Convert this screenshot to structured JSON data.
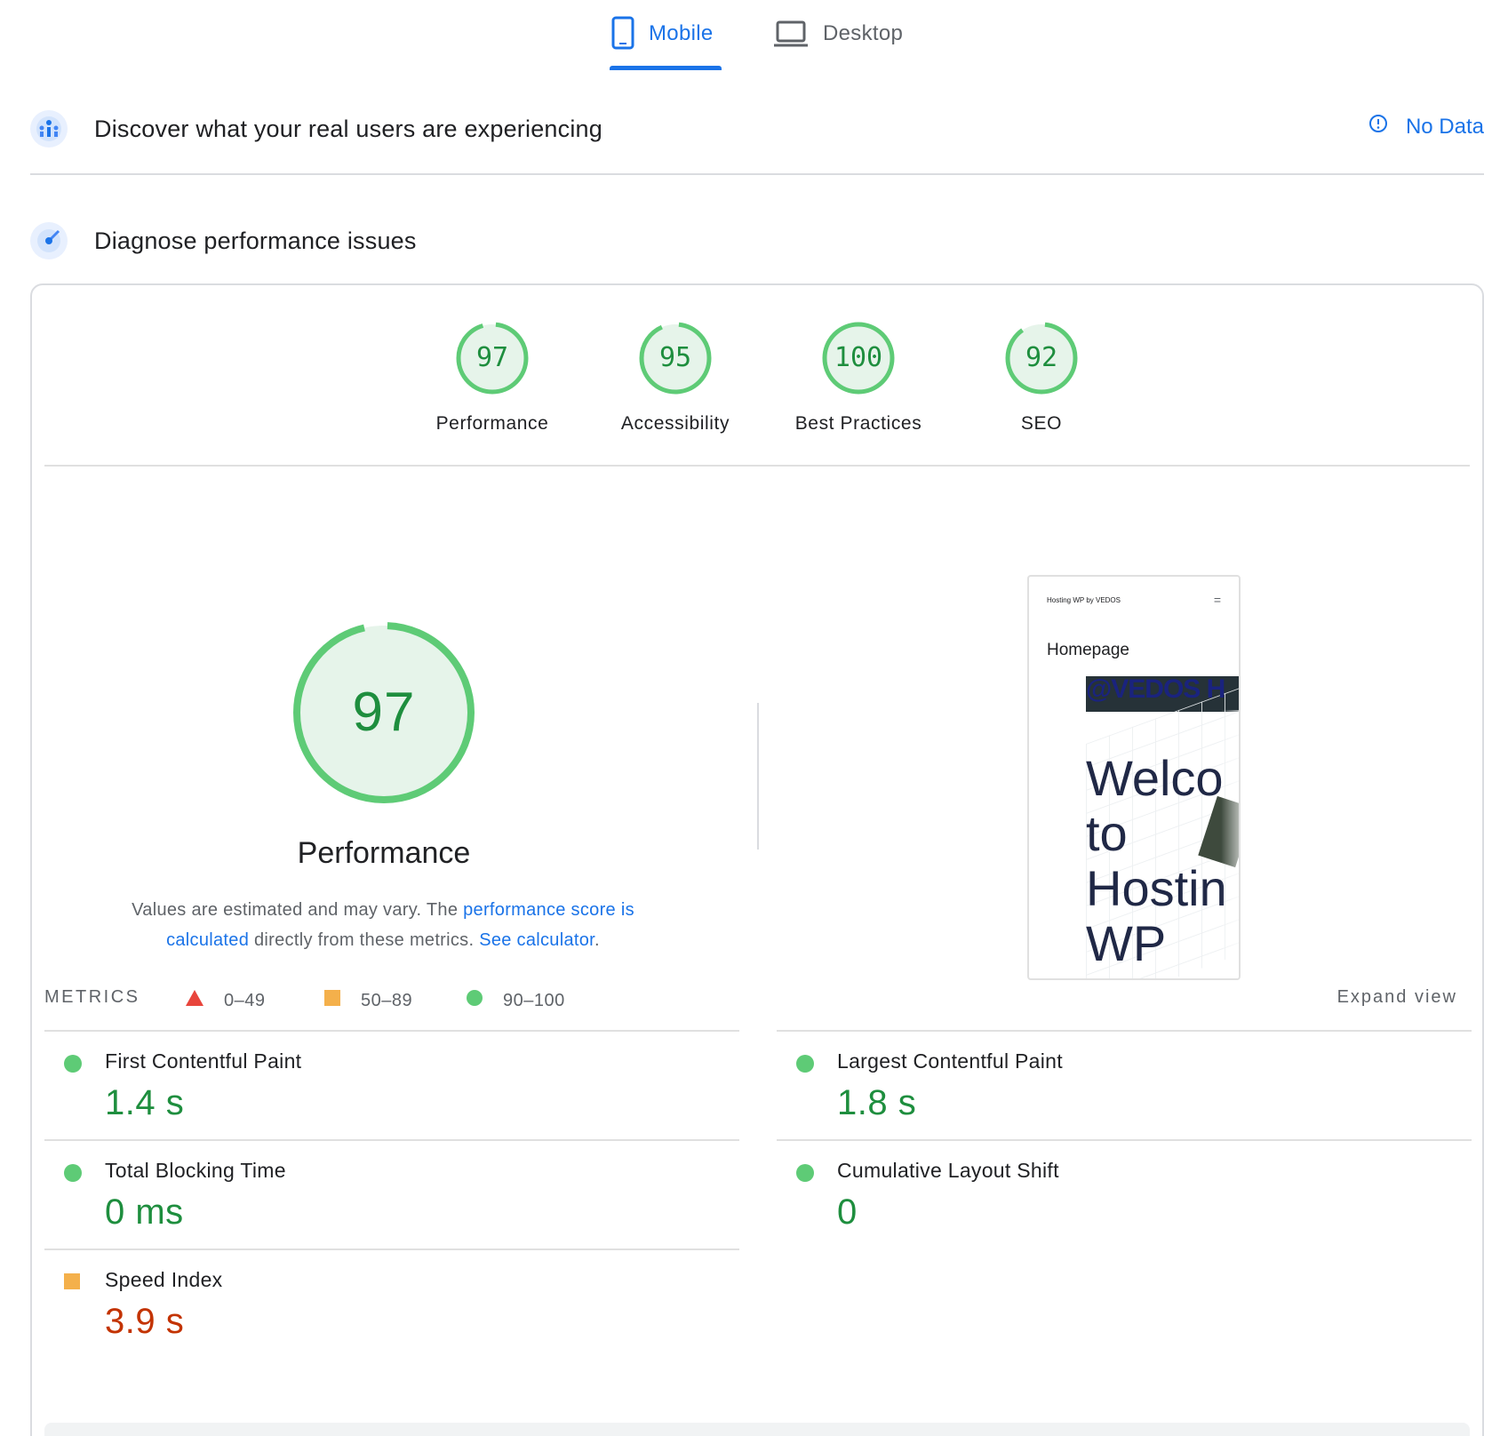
{
  "tabs": {
    "mobile_label": "Mobile",
    "desktop_label": "Desktop",
    "active": "Mobile"
  },
  "field_data": {
    "title": "Discover what your real users are experiencing",
    "status": "No Data",
    "status_icon": "info-icon"
  },
  "diagnose": {
    "title": "Diagnose performance issues"
  },
  "scores": [
    {
      "label": "Performance",
      "value": "97"
    },
    {
      "label": "Accessibility",
      "value": "95"
    },
    {
      "label": "Best Practices",
      "value": "100"
    },
    {
      "label": "SEO",
      "value": "92"
    }
  ],
  "performance": {
    "score": "97",
    "title": "Performance",
    "explain_text_1": "Values are estimated and may vary. The ",
    "explain_link_1": "performance score is calculated",
    "explain_text_2": " directly from these metrics. ",
    "explain_link_2": "See calculator",
    "explain_text_3": "."
  },
  "legend": [
    {
      "shape": "triangle",
      "range": "0–49",
      "color": "#e8453c"
    },
    {
      "shape": "square",
      "range": "50–89",
      "color": "#f4b04b"
    },
    {
      "shape": "circle",
      "range": "90–100",
      "color": "#5ecb76"
    }
  ],
  "screenshot": {
    "site_header": "Hosting WP by VEDOS",
    "menu_icon": "=",
    "page_title": "Homepage",
    "brand": "@VEDOS H",
    "hero_text": [
      "Welco",
      "to",
      "Hostin",
      "WP"
    ]
  },
  "metrics": {
    "label": "METRICS",
    "expand_label": "Expand view",
    "left": [
      {
        "name": "First Contentful Paint",
        "value": "1.4 s",
        "rating": "good"
      },
      {
        "name": "Total Blocking Time",
        "value": "0 ms",
        "rating": "good"
      },
      {
        "name": "Speed Index",
        "value": "3.9 s",
        "rating": "average"
      }
    ],
    "right": [
      {
        "name": "Largest Contentful Paint",
        "value": "1.8 s",
        "rating": "good"
      },
      {
        "name": "Cumulative Layout Shift",
        "value": "0",
        "rating": "good"
      }
    ]
  },
  "colors": {
    "accent": "#1a73e8",
    "good": "#1e8e3e",
    "good_ring": "#5ecb76",
    "average": "#f4b04b",
    "poor": "#e8453c",
    "average_text": "#c33300"
  }
}
